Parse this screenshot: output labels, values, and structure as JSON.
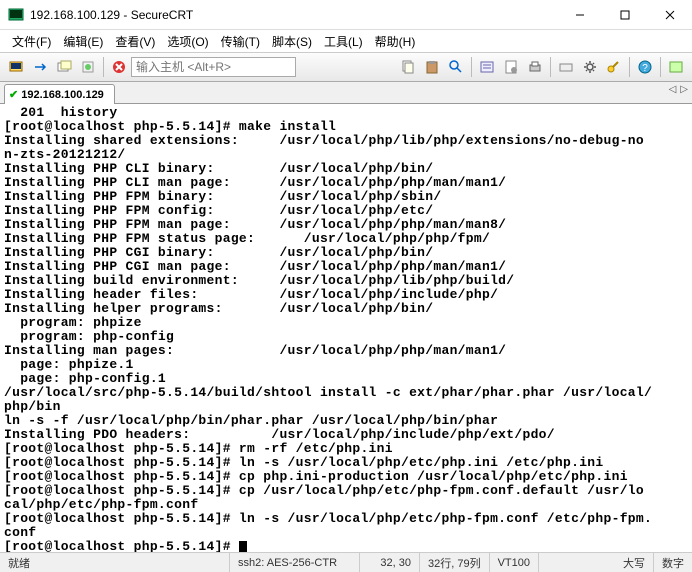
{
  "window": {
    "title": "192.168.100.129 - SecureCRT"
  },
  "menu": {
    "file": "文件(F)",
    "edit": "编辑(E)",
    "view": "查看(V)",
    "options": "选项(O)",
    "transfer": "传输(T)",
    "script": "脚本(S)",
    "tools": "工具(L)",
    "help": "帮助(H)"
  },
  "toolbar": {
    "host_placeholder": "输入主机 <Alt+R>"
  },
  "tab": {
    "label": "192.168.100.129"
  },
  "terminal": {
    "lines": [
      "  201  history",
      "[root@localhost php-5.5.14]# make install",
      "Installing shared extensions:     /usr/local/php/lib/php/extensions/no-debug-no",
      "n-zts-20121212/",
      "Installing PHP CLI binary:        /usr/local/php/bin/",
      "Installing PHP CLI man page:      /usr/local/php/php/man/man1/",
      "Installing PHP FPM binary:        /usr/local/php/sbin/",
      "Installing PHP FPM config:        /usr/local/php/etc/",
      "Installing PHP FPM man page:      /usr/local/php/php/man/man8/",
      "Installing PHP FPM status page:      /usr/local/php/php/fpm/",
      "Installing PHP CGI binary:        /usr/local/php/bin/",
      "Installing PHP CGI man page:      /usr/local/php/php/man/man1/",
      "Installing build environment:     /usr/local/php/lib/php/build/",
      "Installing header files:          /usr/local/php/include/php/",
      "Installing helper programs:       /usr/local/php/bin/",
      "  program: phpize",
      "  program: php-config",
      "Installing man pages:             /usr/local/php/php/man/man1/",
      "  page: phpize.1",
      "  page: php-config.1",
      "/usr/local/src/php-5.5.14/build/shtool install -c ext/phar/phar.phar /usr/local/",
      "php/bin",
      "ln -s -f /usr/local/php/bin/phar.phar /usr/local/php/bin/phar",
      "Installing PDO headers:          /usr/local/php/include/php/ext/pdo/",
      "[root@localhost php-5.5.14]# rm -rf /etc/php.ini",
      "[root@localhost php-5.5.14]# ln -s /usr/local/php/etc/php.ini /etc/php.ini",
      "[root@localhost php-5.5.14]# cp php.ini-production /usr/local/php/etc/php.ini",
      "[root@localhost php-5.5.14]# cp /usr/local/php/etc/php-fpm.conf.default /usr/lo",
      "cal/php/etc/php-fpm.conf",
      "[root@localhost php-5.5.14]# ln -s /usr/local/php/etc/php-fpm.conf /etc/php-fpm.",
      "conf",
      "[root@localhost php-5.5.14]# "
    ]
  },
  "status": {
    "ready": "就绪",
    "ssh": "ssh2: AES-256-CTR",
    "cursor": "32, 30",
    "size": "32行, 79列",
    "term": "VT100",
    "caps": "大写",
    "num": "数字"
  }
}
